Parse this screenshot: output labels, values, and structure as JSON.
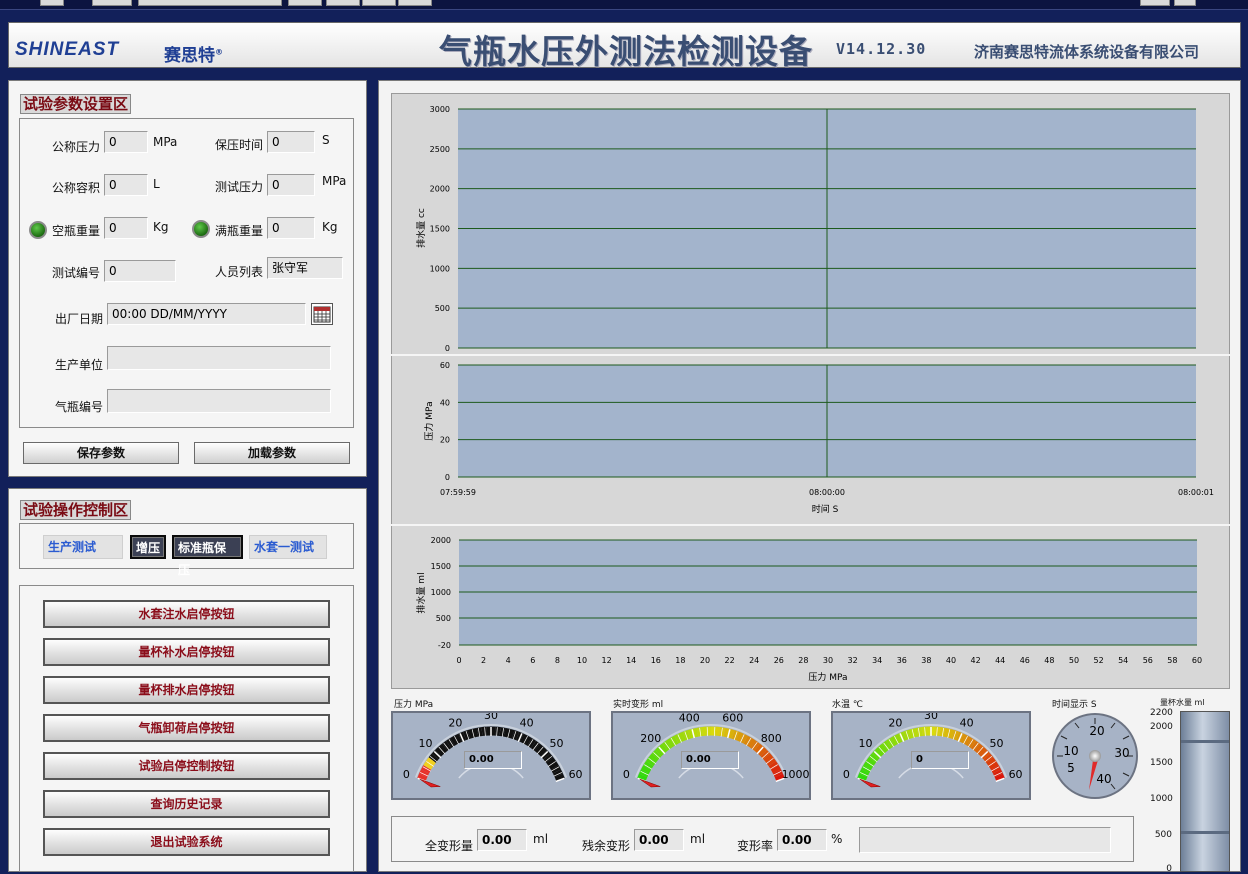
{
  "banner": {
    "logo": "SHINEAST",
    "logo_cn": "赛思特",
    "reg": "®",
    "title": "气瓶水压外测法检测设备",
    "version": "V14.12.30",
    "company": "济南赛思特流体系统设备有限公司"
  },
  "params": {
    "section_title": "试验参数设置区",
    "nominal_pressure": {
      "label": "公称压力",
      "value": "0",
      "unit": "MPa"
    },
    "hold_time": {
      "label": "保压时间",
      "value": "0",
      "unit": "S"
    },
    "nominal_volume": {
      "label": "公称容积",
      "value": "0",
      "unit": "L"
    },
    "test_pressure": {
      "label": "测试压力",
      "value": "0",
      "unit": "MPa"
    },
    "empty_weight": {
      "label": "空瓶重量",
      "value": "0",
      "unit": "Kg"
    },
    "full_weight": {
      "label": "满瓶重量",
      "value": "0",
      "unit": "Kg"
    },
    "test_number": {
      "label": "测试编号",
      "value": "0"
    },
    "staff": {
      "label": "人员列表",
      "value": "张守军"
    },
    "mfg_date": {
      "label": "出厂日期",
      "value": "00:00 DD/MM/YYYY"
    },
    "maker": {
      "label": "生产单位",
      "value": ""
    },
    "cylinder_no": {
      "label": "气瓶编号",
      "value": ""
    },
    "save_btn": "保存参数",
    "load_btn": "加载参数"
  },
  "control": {
    "section_title": "试验操作控制区",
    "modes": [
      "生产测试",
      "增压",
      "标准瓶保压",
      "水套一测试"
    ],
    "buttons": [
      "水套注水启停按钮",
      "量杯补水启停按钮",
      "量杯排水启停按钮",
      "气瓶卸荷启停按钮",
      "试验启停控制按钮",
      "查询历史记录",
      "退出试验系统"
    ]
  },
  "chart_data": [
    {
      "type": "line",
      "ylabel": "排水量 cc",
      "ylim": [
        0,
        3000
      ],
      "yticks": [
        "0",
        "500",
        "1000",
        "1500",
        "2000",
        "2500",
        "3000"
      ],
      "series": [],
      "grid": true
    },
    {
      "type": "line",
      "ylabel": "压力 MPa",
      "xlabel": "时间 S",
      "ylim": [
        0,
        60
      ],
      "yticks": [
        "0",
        "20",
        "40",
        "60"
      ],
      "xticks": [
        "07:59:59",
        "08:00:00",
        "08:00:01"
      ],
      "series": [],
      "grid": true
    },
    {
      "type": "line",
      "ylabel": "排水量 ml",
      "xlabel": "压力 MPa",
      "ylim": [
        -20,
        2000
      ],
      "xlim": [
        0,
        60
      ],
      "yticks": [
        "-20",
        "500",
        "1000",
        "1500",
        "2000"
      ],
      "xticks": [
        "0",
        "2",
        "4",
        "6",
        "8",
        "10",
        "12",
        "14",
        "16",
        "18",
        "20",
        "22",
        "24",
        "26",
        "28",
        "30",
        "32",
        "34",
        "36",
        "38",
        "40",
        "42",
        "44",
        "46",
        "48",
        "50",
        "52",
        "54",
        "56",
        "58",
        "60"
      ],
      "series": [],
      "grid": true
    }
  ],
  "gauges": [
    {
      "label": "压力 MPa",
      "ticks": [
        "0",
        "10",
        "20",
        "30",
        "40",
        "50",
        "60"
      ],
      "min": 0,
      "max": 60,
      "value": 0,
      "readout": "0.00"
    },
    {
      "label": "实时变形 ml",
      "ticks": [
        "0",
        "200",
        "400",
        "600",
        "800",
        "1000"
      ],
      "min": 0,
      "max": 1000,
      "value": 0,
      "readout": "0.00"
    },
    {
      "label": "水温 ℃",
      "ticks": [
        "0",
        "10",
        "20",
        "30",
        "40",
        "50",
        "60"
      ],
      "min": 0,
      "max": 60,
      "value": 0,
      "readout": "0"
    }
  ],
  "timer": {
    "label": "时间显示 S",
    "ticks": [
      "5",
      "10",
      "20",
      "30",
      "40"
    ]
  },
  "cup": {
    "label": "量杯水量 ml",
    "ticks": [
      "2200",
      "2000",
      "1500",
      "1000",
      "500",
      "0"
    ]
  },
  "results": {
    "total": {
      "label": "全变形量",
      "value": "0.00",
      "unit": "ml"
    },
    "residual": {
      "label": "残余变形",
      "value": "0.00",
      "unit": "ml"
    },
    "rate": {
      "label": "变形率",
      "value": "0.00",
      "unit": "%"
    },
    "status": ""
  },
  "colors": {
    "plot_bg": "#a3b4cc",
    "grid": "#1d5a1d",
    "accent": "#7a0b14",
    "banner_text": "#3a4e73"
  }
}
